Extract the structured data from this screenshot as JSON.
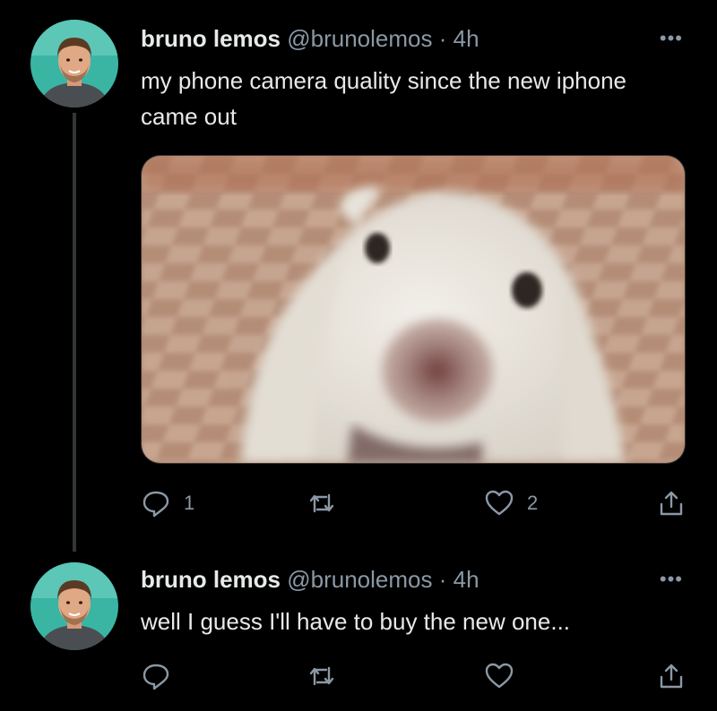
{
  "tweets": [
    {
      "author_name": "bruno lemos",
      "author_handle": "@brunolemos",
      "separator": "·",
      "time": "4h",
      "text": "my phone camera quality since the new iphone came out",
      "reply_count": "1",
      "retweet_count": "",
      "like_count": "2"
    },
    {
      "author_name": "bruno lemos",
      "author_handle": "@brunolemos",
      "separator": "·",
      "time": "4h",
      "text": "well I guess I'll have to buy the new one...",
      "reply_count": "",
      "retweet_count": "",
      "like_count": ""
    }
  ],
  "more_label": "•••",
  "colors": {
    "background": "#000000",
    "text": "#e7e9ea",
    "muted": "#8b98a5",
    "avatar_bg": "#3ab5a4"
  },
  "icons": [
    "reply-icon",
    "retweet-icon",
    "like-icon",
    "share-icon",
    "more-icon"
  ]
}
